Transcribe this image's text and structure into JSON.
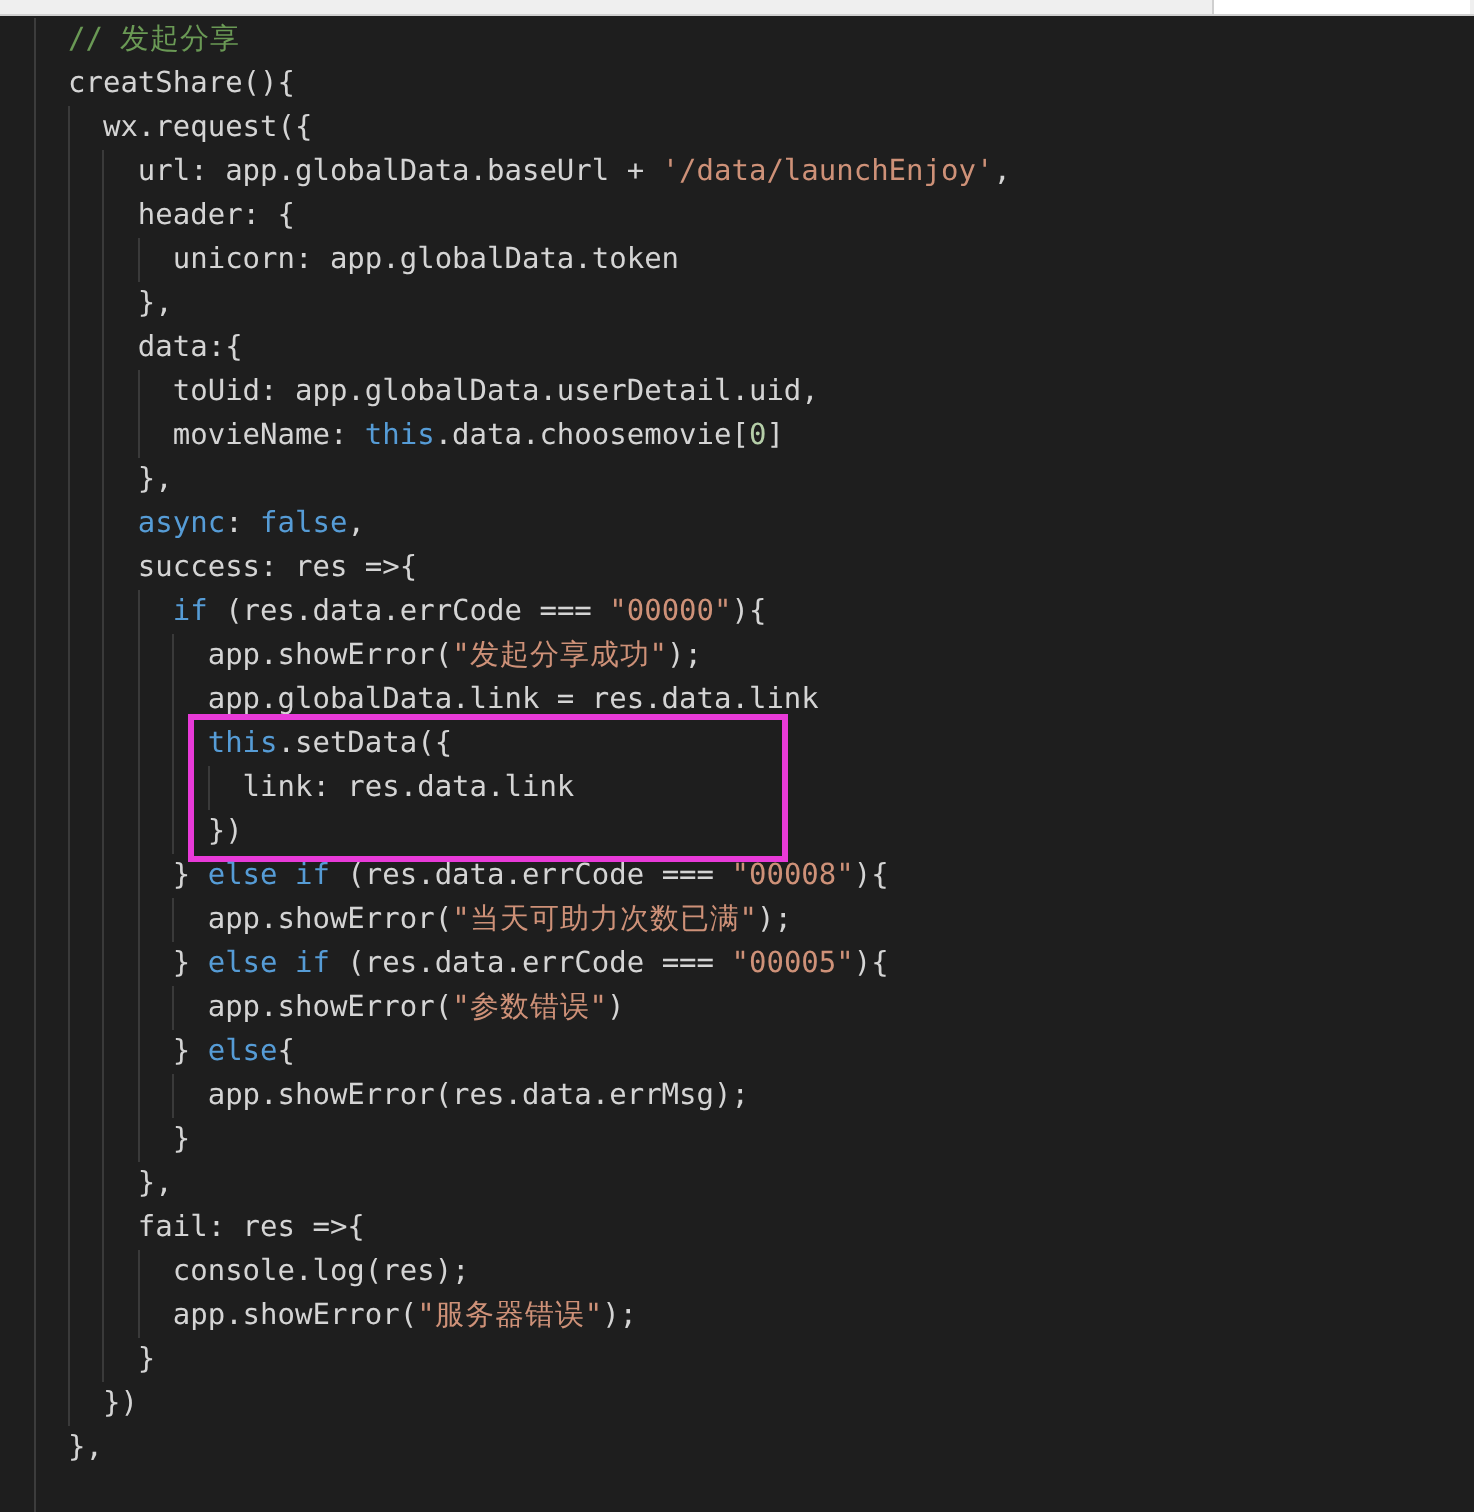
{
  "lines": [
    {
      "tokens": [
        {
          "text": "// 发起分享",
          "color": "#6a9955"
        }
      ]
    },
    {
      "tokens": [
        {
          "text": "creatShare(){",
          "color": "#d4d4d4"
        }
      ]
    },
    {
      "tokens": [
        {
          "text": "  wx.request({",
          "color": "#d4d4d4"
        }
      ]
    },
    {
      "tokens": [
        {
          "text": "    url: app.globalData.baseUrl + ",
          "color": "#d4d4d4"
        },
        {
          "text": "'/data/launchEnjoy'",
          "color": "#ce9178"
        },
        {
          "text": ",",
          "color": "#d4d4d4"
        }
      ]
    },
    {
      "tokens": [
        {
          "text": "    header: {",
          "color": "#d4d4d4"
        }
      ]
    },
    {
      "tokens": [
        {
          "text": "      unicorn: app.globalData.token",
          "color": "#d4d4d4"
        }
      ]
    },
    {
      "tokens": [
        {
          "text": "    },",
          "color": "#d4d4d4"
        }
      ]
    },
    {
      "tokens": [
        {
          "text": "    data:{",
          "color": "#d4d4d4"
        }
      ]
    },
    {
      "tokens": [
        {
          "text": "      toUid: app.globalData.userDetail.uid,",
          "color": "#d4d4d4"
        }
      ]
    },
    {
      "tokens": [
        {
          "text": "      movieName: ",
          "color": "#d4d4d4"
        },
        {
          "text": "this",
          "color": "#569cd6"
        },
        {
          "text": ".data.choosemovie[",
          "color": "#d4d4d4"
        },
        {
          "text": "0",
          "color": "#b5cea8"
        },
        {
          "text": "]",
          "color": "#d4d4d4"
        }
      ]
    },
    {
      "tokens": [
        {
          "text": "    },",
          "color": "#d4d4d4"
        }
      ]
    },
    {
      "tokens": [
        {
          "text": "    async",
          "color": "#569cd6"
        },
        {
          "text": ": ",
          "color": "#d4d4d4"
        },
        {
          "text": "false",
          "color": "#569cd6"
        },
        {
          "text": ",",
          "color": "#d4d4d4"
        }
      ]
    },
    {
      "tokens": [
        {
          "text": "    success: res =>{",
          "color": "#d4d4d4"
        }
      ]
    },
    {
      "tokens": [
        {
          "text": "      if",
          "color": "#569cd6"
        },
        {
          "text": " (res.data.errCode === ",
          "color": "#d4d4d4"
        },
        {
          "text": "\"00000\"",
          "color": "#ce9178"
        },
        {
          "text": "){",
          "color": "#d4d4d4"
        }
      ]
    },
    {
      "tokens": [
        {
          "text": "        app.showError(",
          "color": "#d4d4d4"
        },
        {
          "text": "\"发起分享成功\"",
          "color": "#ce9178"
        },
        {
          "text": ");",
          "color": "#d4d4d4"
        }
      ]
    },
    {
      "tokens": [
        {
          "text": "        app.globalData.link = res.data.link",
          "color": "#d4d4d4"
        }
      ]
    },
    {
      "boxed": true,
      "tokens": [
        {
          "text": "        this",
          "color": "#569cd6"
        },
        {
          "text": ".setData({",
          "color": "#d4d4d4"
        }
      ]
    },
    {
      "boxed": true,
      "tokens": [
        {
          "text": "          link: res.data.link",
          "color": "#d4d4d4"
        }
      ]
    },
    {
      "boxed": true,
      "tokens": [
        {
          "text": "        })",
          "color": "#d4d4d4"
        }
      ]
    },
    {
      "tokens": [
        {
          "text": "      } ",
          "color": "#d4d4d4"
        },
        {
          "text": "else if",
          "color": "#569cd6"
        },
        {
          "text": " (res.data.errCode === ",
          "color": "#d4d4d4"
        },
        {
          "text": "\"00008\"",
          "color": "#ce9178"
        },
        {
          "text": "){",
          "color": "#d4d4d4"
        }
      ]
    },
    {
      "tokens": [
        {
          "text": "        app.showError(",
          "color": "#d4d4d4"
        },
        {
          "text": "\"当天可助力次数已满\"",
          "color": "#ce9178"
        },
        {
          "text": ");",
          "color": "#d4d4d4"
        }
      ]
    },
    {
      "tokens": [
        {
          "text": "      } ",
          "color": "#d4d4d4"
        },
        {
          "text": "else if",
          "color": "#569cd6"
        },
        {
          "text": " (res.data.errCode === ",
          "color": "#d4d4d4"
        },
        {
          "text": "\"00005\"",
          "color": "#ce9178"
        },
        {
          "text": "){",
          "color": "#d4d4d4"
        }
      ]
    },
    {
      "tokens": [
        {
          "text": "        app.showError(",
          "color": "#d4d4d4"
        },
        {
          "text": "\"参数错误\"",
          "color": "#ce9178"
        },
        {
          "text": ")",
          "color": "#d4d4d4"
        }
      ]
    },
    {
      "tokens": [
        {
          "text": "      } ",
          "color": "#d4d4d4"
        },
        {
          "text": "else",
          "color": "#569cd6"
        },
        {
          "text": "{",
          "color": "#d4d4d4"
        }
      ]
    },
    {
      "tokens": [
        {
          "text": "        app.showError(res.data.errMsg);",
          "color": "#d4d4d4"
        }
      ]
    },
    {
      "tokens": [
        {
          "text": "      }",
          "color": "#d4d4d4"
        }
      ]
    },
    {
      "tokens": [
        {
          "text": "    },",
          "color": "#d4d4d4"
        }
      ]
    },
    {
      "tokens": [
        {
          "text": "    fail: res =>{",
          "color": "#d4d4d4"
        }
      ]
    },
    {
      "tokens": [
        {
          "text": "      console.log(res);",
          "color": "#d4d4d4"
        }
      ]
    },
    {
      "tokens": [
        {
          "text": "      app.showError(",
          "color": "#d4d4d4"
        },
        {
          "text": "\"服务器错误\"",
          "color": "#ce9178"
        },
        {
          "text": ");",
          "color": "#d4d4d4"
        }
      ]
    },
    {
      "tokens": [
        {
          "text": "    }",
          "color": "#d4d4d4"
        }
      ]
    },
    {
      "tokens": [
        {
          "text": "  })",
          "color": "#d4d4d4"
        }
      ]
    },
    {
      "tokens": [
        {
          "text": "},",
          "color": "#d4d4d4"
        }
      ]
    }
  ]
}
